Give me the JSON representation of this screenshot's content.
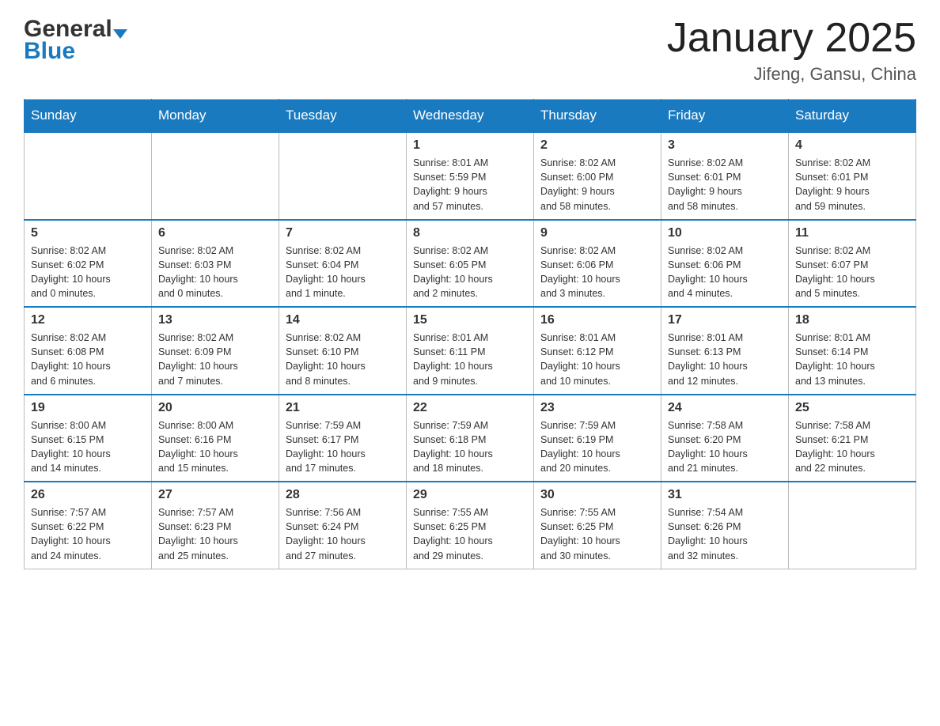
{
  "header": {
    "logo_name": "General",
    "logo_blue": "Blue",
    "month_year": "January 2025",
    "location": "Jifeng, Gansu, China"
  },
  "days_of_week": [
    "Sunday",
    "Monday",
    "Tuesday",
    "Wednesday",
    "Thursday",
    "Friday",
    "Saturday"
  ],
  "weeks": [
    [
      {
        "day": "",
        "info": ""
      },
      {
        "day": "",
        "info": ""
      },
      {
        "day": "",
        "info": ""
      },
      {
        "day": "1",
        "info": "Sunrise: 8:01 AM\nSunset: 5:59 PM\nDaylight: 9 hours\nand 57 minutes."
      },
      {
        "day": "2",
        "info": "Sunrise: 8:02 AM\nSunset: 6:00 PM\nDaylight: 9 hours\nand 58 minutes."
      },
      {
        "day": "3",
        "info": "Sunrise: 8:02 AM\nSunset: 6:01 PM\nDaylight: 9 hours\nand 58 minutes."
      },
      {
        "day": "4",
        "info": "Sunrise: 8:02 AM\nSunset: 6:01 PM\nDaylight: 9 hours\nand 59 minutes."
      }
    ],
    [
      {
        "day": "5",
        "info": "Sunrise: 8:02 AM\nSunset: 6:02 PM\nDaylight: 10 hours\nand 0 minutes."
      },
      {
        "day": "6",
        "info": "Sunrise: 8:02 AM\nSunset: 6:03 PM\nDaylight: 10 hours\nand 0 minutes."
      },
      {
        "day": "7",
        "info": "Sunrise: 8:02 AM\nSunset: 6:04 PM\nDaylight: 10 hours\nand 1 minute."
      },
      {
        "day": "8",
        "info": "Sunrise: 8:02 AM\nSunset: 6:05 PM\nDaylight: 10 hours\nand 2 minutes."
      },
      {
        "day": "9",
        "info": "Sunrise: 8:02 AM\nSunset: 6:06 PM\nDaylight: 10 hours\nand 3 minutes."
      },
      {
        "day": "10",
        "info": "Sunrise: 8:02 AM\nSunset: 6:06 PM\nDaylight: 10 hours\nand 4 minutes."
      },
      {
        "day": "11",
        "info": "Sunrise: 8:02 AM\nSunset: 6:07 PM\nDaylight: 10 hours\nand 5 minutes."
      }
    ],
    [
      {
        "day": "12",
        "info": "Sunrise: 8:02 AM\nSunset: 6:08 PM\nDaylight: 10 hours\nand 6 minutes."
      },
      {
        "day": "13",
        "info": "Sunrise: 8:02 AM\nSunset: 6:09 PM\nDaylight: 10 hours\nand 7 minutes."
      },
      {
        "day": "14",
        "info": "Sunrise: 8:02 AM\nSunset: 6:10 PM\nDaylight: 10 hours\nand 8 minutes."
      },
      {
        "day": "15",
        "info": "Sunrise: 8:01 AM\nSunset: 6:11 PM\nDaylight: 10 hours\nand 9 minutes."
      },
      {
        "day": "16",
        "info": "Sunrise: 8:01 AM\nSunset: 6:12 PM\nDaylight: 10 hours\nand 10 minutes."
      },
      {
        "day": "17",
        "info": "Sunrise: 8:01 AM\nSunset: 6:13 PM\nDaylight: 10 hours\nand 12 minutes."
      },
      {
        "day": "18",
        "info": "Sunrise: 8:01 AM\nSunset: 6:14 PM\nDaylight: 10 hours\nand 13 minutes."
      }
    ],
    [
      {
        "day": "19",
        "info": "Sunrise: 8:00 AM\nSunset: 6:15 PM\nDaylight: 10 hours\nand 14 minutes."
      },
      {
        "day": "20",
        "info": "Sunrise: 8:00 AM\nSunset: 6:16 PM\nDaylight: 10 hours\nand 15 minutes."
      },
      {
        "day": "21",
        "info": "Sunrise: 7:59 AM\nSunset: 6:17 PM\nDaylight: 10 hours\nand 17 minutes."
      },
      {
        "day": "22",
        "info": "Sunrise: 7:59 AM\nSunset: 6:18 PM\nDaylight: 10 hours\nand 18 minutes."
      },
      {
        "day": "23",
        "info": "Sunrise: 7:59 AM\nSunset: 6:19 PM\nDaylight: 10 hours\nand 20 minutes."
      },
      {
        "day": "24",
        "info": "Sunrise: 7:58 AM\nSunset: 6:20 PM\nDaylight: 10 hours\nand 21 minutes."
      },
      {
        "day": "25",
        "info": "Sunrise: 7:58 AM\nSunset: 6:21 PM\nDaylight: 10 hours\nand 22 minutes."
      }
    ],
    [
      {
        "day": "26",
        "info": "Sunrise: 7:57 AM\nSunset: 6:22 PM\nDaylight: 10 hours\nand 24 minutes."
      },
      {
        "day": "27",
        "info": "Sunrise: 7:57 AM\nSunset: 6:23 PM\nDaylight: 10 hours\nand 25 minutes."
      },
      {
        "day": "28",
        "info": "Sunrise: 7:56 AM\nSunset: 6:24 PM\nDaylight: 10 hours\nand 27 minutes."
      },
      {
        "day": "29",
        "info": "Sunrise: 7:55 AM\nSunset: 6:25 PM\nDaylight: 10 hours\nand 29 minutes."
      },
      {
        "day": "30",
        "info": "Sunrise: 7:55 AM\nSunset: 6:25 PM\nDaylight: 10 hours\nand 30 minutes."
      },
      {
        "day": "31",
        "info": "Sunrise: 7:54 AM\nSunset: 6:26 PM\nDaylight: 10 hours\nand 32 minutes."
      },
      {
        "day": "",
        "info": ""
      }
    ]
  ]
}
